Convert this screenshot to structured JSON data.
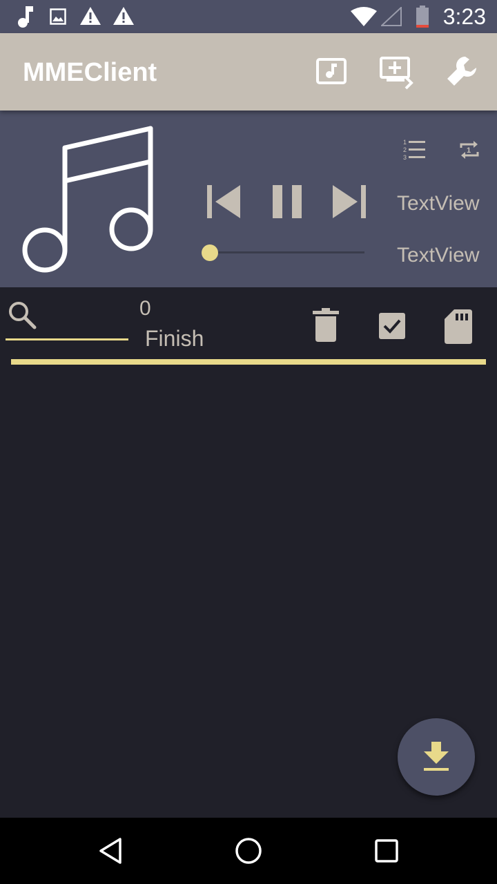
{
  "status_bar": {
    "time": "3:23",
    "notification_icons": [
      "music-note-icon",
      "image-icon",
      "warning-icon",
      "warning-icon"
    ],
    "system_icons": [
      "wifi-icon",
      "cellular-icon",
      "battery-icon"
    ]
  },
  "app_bar": {
    "title": "MMEClient",
    "actions": [
      "music-library-icon",
      "add-to-queue-icon",
      "settings-wrench-icon"
    ]
  },
  "player": {
    "artwork": "music-notes-icon",
    "controls": [
      "skip-previous-icon",
      "pause-icon",
      "skip-next-icon"
    ],
    "track_text": "TextView",
    "time_text": "TextView",
    "seek_progress": 0,
    "mode_icons": [
      "playlist-numbered-icon",
      "repeat-one-icon"
    ]
  },
  "toolbar": {
    "count": "0",
    "status": "Finish",
    "actions": [
      "search-icon",
      "delete-icon",
      "select-all-icon",
      "sd-card-icon"
    ]
  },
  "fab": {
    "icon": "download-icon"
  },
  "nav_bar": {
    "buttons": [
      "back-icon",
      "home-icon",
      "recents-icon"
    ]
  },
  "colors": {
    "status_bar": "#4d5066",
    "app_bar": "#c5beb4",
    "player_bg": "#4d5066",
    "content_bg": "#202029",
    "accent": "#e8d98a",
    "icon": "#c5beb4"
  }
}
